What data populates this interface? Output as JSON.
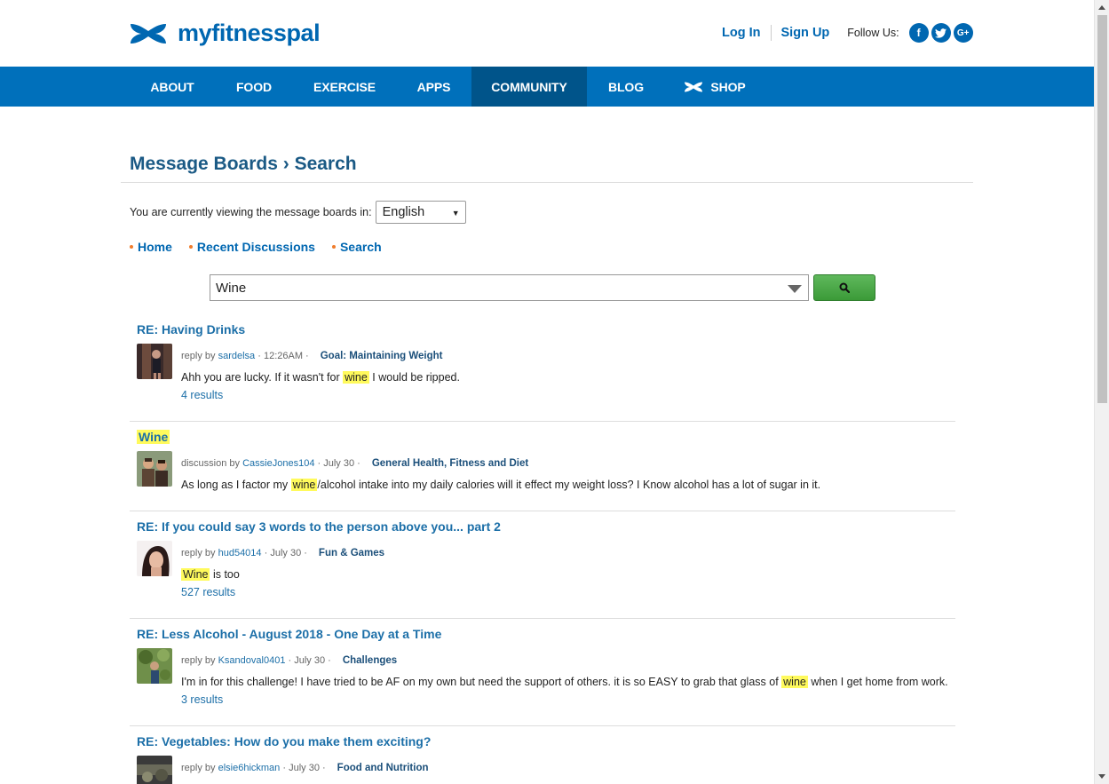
{
  "header": {
    "logo_text": "myfitnesspal",
    "login": "Log In",
    "signup": "Sign Up",
    "follow_label": "Follow Us:",
    "social": [
      {
        "icon": "facebook-icon",
        "glyph": "f"
      },
      {
        "icon": "twitter-icon",
        "glyph": "t"
      },
      {
        "icon": "google-plus-icon",
        "glyph": "G+"
      }
    ]
  },
  "nav": {
    "items": [
      "ABOUT",
      "FOOD",
      "EXERCISE",
      "APPS",
      "COMMUNITY",
      "BLOG",
      "SHOP"
    ],
    "active": "COMMUNITY"
  },
  "page": {
    "title": "Message Boards › Search",
    "lang_label": "You are currently viewing the message boards in:",
    "lang_value": "English",
    "subnav": [
      "Home",
      "Recent Discussions",
      "Search"
    ],
    "search_value": "Wine"
  },
  "results": [
    {
      "title": "RE: Having Drinks",
      "type": "reply by",
      "user": "sardelsa",
      "time": "12:26AM",
      "category": "Goal: Maintaining Weight",
      "excerpt_before": "Ahh you are lucky. If it wasn't for ",
      "excerpt_hl": "wine",
      "excerpt_after": " I would be ripped.",
      "count": "4 results"
    },
    {
      "title": "Wine",
      "type": "discussion by",
      "user": "CassieJones104",
      "time": "July 30",
      "category": "General Health, Fitness and Diet",
      "excerpt_before": "As long as I factor my ",
      "excerpt_hl": "wine",
      "excerpt_after": "/alcohol intake into my daily calories will it effect my weight loss? I Know alcohol has a lot of sugar in it.",
      "count": ""
    },
    {
      "title": "RE: If you could say 3 words to the person above you... part 2",
      "type": "reply by",
      "user": "hud54014",
      "time": "July 30",
      "category": "Fun & Games",
      "excerpt_before": "",
      "excerpt_hl": "Wine",
      "excerpt_after": " is too",
      "count": "527 results"
    },
    {
      "title": "RE: Less Alcohol - August 2018 - One Day at a Time",
      "type": "reply by",
      "user": "Ksandoval0401",
      "time": "July 30",
      "category": "Challenges",
      "excerpt_before": "I'm in for this challenge! I have tried to be AF on my own but need the support of others. it is so EASY to grab that glass of ",
      "excerpt_hl": "wine",
      "excerpt_after": " when I get home from work.",
      "count": "3 results"
    },
    {
      "title": "RE: Vegetables: How do you make them exciting?",
      "type": "reply by",
      "user": "elsie6hickman",
      "time": "July 30",
      "category": "Food and Nutrition",
      "excerpt_before": "",
      "excerpt_hl": "",
      "excerpt_after": "",
      "count": ""
    }
  ],
  "colors": {
    "brand_blue": "#0067b1",
    "nav_blue": "#0070bb",
    "nav_active": "#00548a",
    "search_green": "#4caf50",
    "highlight": "#fffa5c",
    "bullet_orange": "#f07c2c"
  }
}
